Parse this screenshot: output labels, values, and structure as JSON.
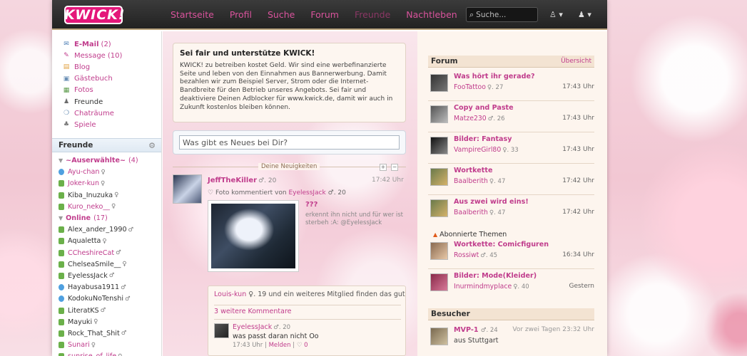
{
  "header": {
    "logo": "KWICK!",
    "nav": [
      "Startseite",
      "Profil",
      "Suche",
      "Forum",
      "Freunde",
      "Nachtleben"
    ],
    "search_placeholder": "Suche..."
  },
  "menu": [
    {
      "label": "E-Mail",
      "count": "(2)",
      "icon": "mail-icon",
      "bold": true
    },
    {
      "label": "Message",
      "count": "(10)",
      "icon": "message-icon"
    },
    {
      "label": "Blog",
      "count": "",
      "icon": "blog-icon"
    },
    {
      "label": "Gästebuch",
      "count": "",
      "icon": "guestbook-icon"
    },
    {
      "label": "Fotos",
      "count": "",
      "icon": "photo-icon"
    },
    {
      "label": "Freunde",
      "count": "",
      "icon": "friends-icon",
      "dark": true
    },
    {
      "label": "Chaträume",
      "count": "",
      "icon": "chat-icon"
    },
    {
      "label": "Spiele",
      "count": "",
      "icon": "games-icon"
    }
  ],
  "friends": {
    "title": "Freunde",
    "groups": [
      {
        "label": "~Auserwählte~",
        "count": "(4)",
        "items": [
          {
            "name": "Ayu-chan",
            "gender": "♀",
            "status": "web"
          },
          {
            "name": "Joker-kun",
            "gender": "♀",
            "status": "phone"
          },
          {
            "name": "Kiba_Inuzuka",
            "gender": "♀",
            "status": "phone"
          },
          {
            "name": "Kuro_neko__",
            "gender": "♀",
            "status": "phone"
          }
        ]
      },
      {
        "label": "Online",
        "count": "(17)",
        "items": [
          {
            "name": "Alex_ander_1990",
            "gender": "♂",
            "status": "phone"
          },
          {
            "name": "Aqualetta",
            "gender": "♀",
            "status": "phone"
          },
          {
            "name": "CCheshireCat",
            "gender": "♂",
            "status": "phone"
          },
          {
            "name": "ChelseaSmile__",
            "gender": "♀",
            "status": "phone"
          },
          {
            "name": "EyelessJack",
            "gender": "♂",
            "status": "phone"
          },
          {
            "name": "Hayabusa1911",
            "gender": "♂",
            "status": "web"
          },
          {
            "name": "KodokuNoTenshi",
            "gender": "♂",
            "status": "web"
          },
          {
            "name": "LiteratKS",
            "gender": "♂",
            "status": "phone"
          },
          {
            "name": "Mayuki",
            "gender": "♀",
            "status": "phone"
          },
          {
            "name": "Rock_That_Shit",
            "gender": "♂",
            "status": "phone"
          },
          {
            "name": "Sunari",
            "gender": "♀",
            "status": "phone"
          },
          {
            "name": "sunrise_of_life",
            "gender": "♀",
            "status": "phone"
          }
        ]
      }
    ]
  },
  "notice": {
    "title": "Sei fair und unterstütze KWICK!",
    "text": "KWICK! zu betreiben kostet Geld. Wir sind eine werbefinanzierte Seite und leben von den Einnahmen aus Bannerwerbung. Damit bezahlen wir zum Beispiel Server, Strom oder die Internet-Bandbreite für den Betrieb unseres Angebots. Sei fair und deaktiviere Deinen Adblocker für www.kwick.de, damit wir auch in Zukunft kostenlos bleiben können."
  },
  "status_placeholder": "Was gibt es Neues bei Dir?",
  "news": {
    "label": "Deine Neuigkeiten",
    "post": {
      "user": "JeffTheKiller",
      "user_meta": "♂. 20",
      "time": "17:42 Uhr",
      "action_prefix": "Foto kommentiert von",
      "action_user": "EyelessJack",
      "action_meta": "♂. 20",
      "photo_title": "???",
      "photo_text": "erkennt ihn nicht und für wer ist sterbeh :A: @EyelessJack"
    },
    "likes": {
      "user": "Louis-kun",
      "user_meta": "♀. 19",
      "text": "und ein weiteres Mitglied finden das gut",
      "more": "3 weitere Kommentare"
    },
    "comment": {
      "user": "EyelessJack",
      "user_meta": "♂. 20",
      "text": "was passt daran nicht Oo",
      "time": "17:43 Uhr",
      "report": "Melden",
      "likes": "0"
    }
  },
  "forum": {
    "title": "Forum",
    "link": "Übersicht",
    "items": [
      {
        "title": "Was hört ihr gerade?",
        "user": "FooTattoo",
        "meta": "♀. 27",
        "time": "17:43 Uhr"
      },
      {
        "title": "Copy and Paste",
        "user": "Matze230",
        "meta": "♂. 26",
        "time": "17:43 Uhr"
      },
      {
        "title": "Bilder: Fantasy",
        "user": "VampireGirl80",
        "meta": "♀. 33",
        "time": "17:43 Uhr"
      },
      {
        "title": "Wortkette",
        "user": "Baalberith",
        "meta": "♀. 47",
        "time": "17:42 Uhr"
      },
      {
        "title": "Aus zwei wird eins!",
        "user": "Baalberith",
        "meta": "♀. 47",
        "time": "17:42 Uhr"
      }
    ],
    "subscribed_label": "Abonnierte Themen",
    "subscribed": [
      {
        "title": "Wortkette: Comicfiguren",
        "user": "Rossiwt",
        "meta": "♂. 45",
        "time": "16:34 Uhr"
      },
      {
        "title": "Bilder: Mode(Kleider)",
        "user": "Inurmindmyplace",
        "meta": "♀. 40",
        "time": "Gestern"
      }
    ]
  },
  "visitors": {
    "title": "Besucher",
    "items": [
      {
        "user": "MVP-1",
        "meta": "♂. 24",
        "time": "Vor zwei Tagen 23:32 Uhr",
        "location": "aus Stuttgart"
      }
    ]
  }
}
